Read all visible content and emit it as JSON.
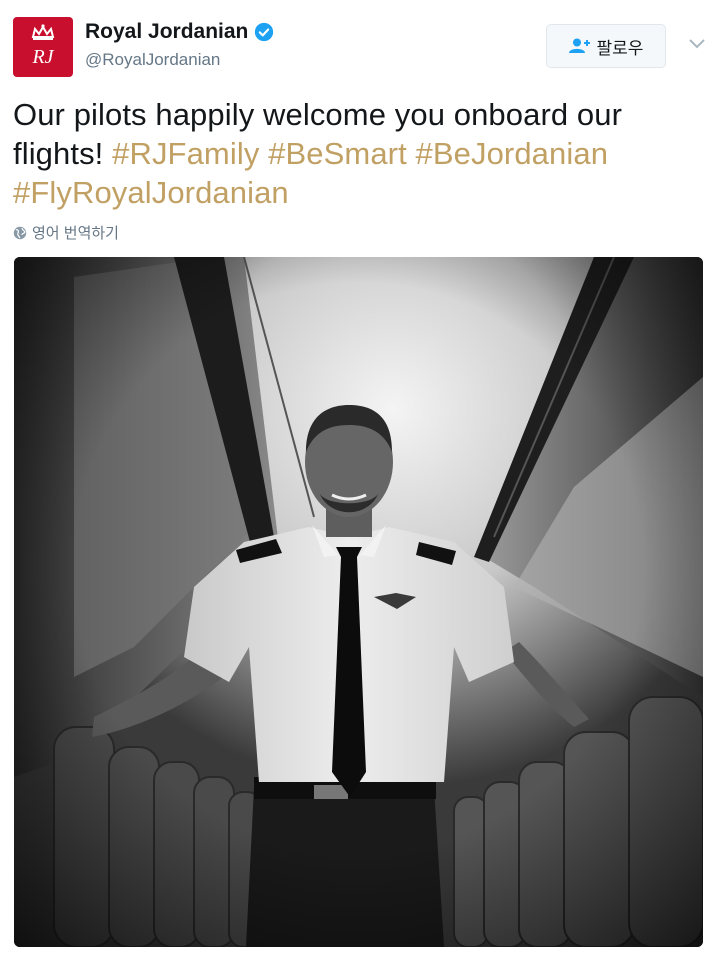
{
  "profile": {
    "name": "Royal Jordanian",
    "handle": "@RoyalJordanian",
    "verified": true,
    "avatar_initials": "RJ",
    "brand_color": "#c8102e"
  },
  "follow_button": {
    "label": "팔로우",
    "icon": "add-user-icon"
  },
  "menu": {
    "icon": "chevron-down-icon"
  },
  "tweet": {
    "text_plain": "Our pilots happily welcome you onboard our flights!",
    "hashtags": [
      "#RJFamily",
      "#BeSmart",
      "#BeJordanian",
      "#FlyRoyalJordanian"
    ],
    "hashtag_color": "#c1a064"
  },
  "translate": {
    "label": "영어 번역하기",
    "icon": "globe-icon"
  },
  "media": {
    "type": "photo",
    "icon": "pilot-photo"
  }
}
